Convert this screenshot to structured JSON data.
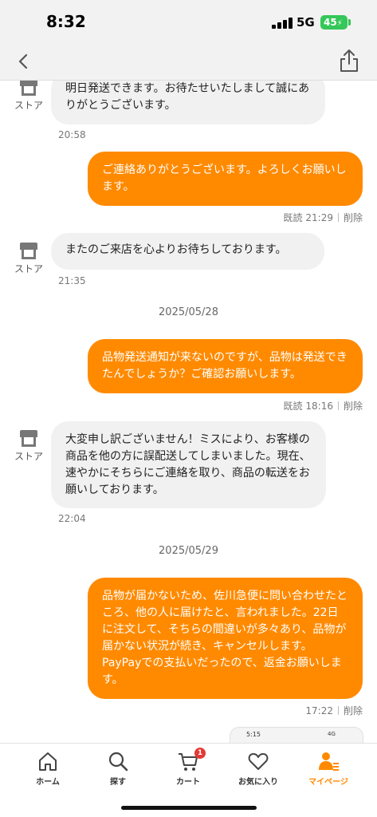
{
  "status": {
    "time": "8:32",
    "network": "5G",
    "battery": "45"
  },
  "nav": {
    "back_icon": "chevron-left-icon",
    "share_icon": "share-icon"
  },
  "chat": {
    "store_label": "ストア",
    "messages": [
      {
        "dir": "in",
        "text": "明日発送できます。お待たせいたしまして誠にありがとうございます。",
        "time": "20:58"
      },
      {
        "dir": "out",
        "text": "ご連絡ありがとうございます。よろしくお願いします。",
        "read": "既読",
        "time": "21:29",
        "delete": "削除"
      },
      {
        "dir": "in",
        "text": "またのご来店を心よりお待ちしております。",
        "time": "21:35"
      },
      {
        "dir": "out",
        "text": "品物発送通知が来ないのですが、品物は発送できたんでしょうか？ご確認お願いします。",
        "read": "既読",
        "time": "18:16",
        "delete": "削除"
      },
      {
        "dir": "in",
        "text": "大変申し訳ございません！ミスにより、お客様の商品を他の方に誤配送してしまいました。現在、速やかにそちらにご連絡を取り、商品の転送をお願いしております。",
        "time": "22:04"
      },
      {
        "dir": "out",
        "text": "品物が届かないため、佐川急便に問い合わせたところ、他の人に届けたと、言われました。22日に注文して、そちらの間違いが多々あり、品物が届かない状況が続き、キャンセルします。PayPayでの支払いだったので、返金お願いします。",
        "time": "17:22",
        "delete": "削除"
      }
    ],
    "dates": [
      "2025/05/28",
      "2025/05/29"
    ],
    "thumbnail": {
      "time": "5:15",
      "status": "4G"
    }
  },
  "tabs": [
    {
      "label": "ホーム",
      "icon": "home-icon"
    },
    {
      "label": "探す",
      "icon": "search-icon"
    },
    {
      "label": "カート",
      "icon": "cart-icon",
      "badge": "1"
    },
    {
      "label": "お気に入り",
      "icon": "heart-icon"
    },
    {
      "label": "マイページ",
      "icon": "mypage-icon",
      "active": true
    }
  ],
  "colors": {
    "accent": "#ff8a00",
    "incoming": "#f1f1f1",
    "badge": "#e53935"
  }
}
